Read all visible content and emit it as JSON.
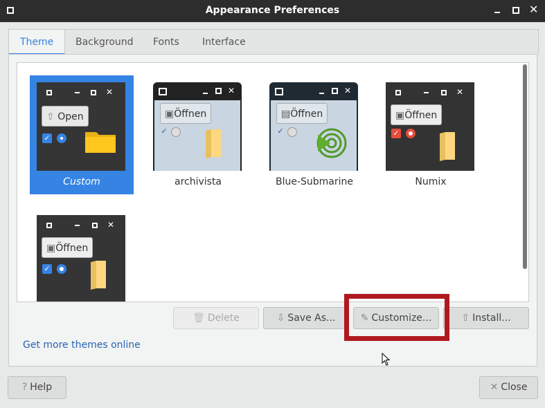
{
  "window": {
    "title": "Appearance Preferences"
  },
  "tabs": [
    {
      "label": "Theme",
      "active": true
    },
    {
      "label": "Background",
      "active": false
    },
    {
      "label": "Fonts",
      "active": false
    },
    {
      "label": "Interface",
      "active": false
    }
  ],
  "themes": [
    {
      "name": "Custom",
      "selected": true,
      "preview": {
        "style": "dark",
        "button_label": "Open",
        "check_color": "#3584e4",
        "radio_color": "#3584e4"
      }
    },
    {
      "name": "archivista",
      "selected": false,
      "preview": {
        "style": "light",
        "button_label": "Öffnen"
      }
    },
    {
      "name": "Blue-Submarine",
      "selected": false,
      "preview": {
        "style": "light",
        "button_label": "Öffnen"
      }
    },
    {
      "name": "Numix",
      "selected": false,
      "preview": {
        "style": "dark",
        "button_label": "Öffnen",
        "check_color": "#e74c3c",
        "radio_color": "#e74c3c"
      }
    },
    {
      "name": "",
      "selected": false,
      "preview": {
        "style": "dark",
        "button_label": "Öffnen",
        "check_color": "#3584e4",
        "radio_color": "#3584e4"
      }
    }
  ],
  "actions": {
    "delete": "Delete",
    "save_as": "Save As...",
    "customize": "Customize...",
    "install": "Install..."
  },
  "link": "Get more themes online",
  "footer": {
    "help": "Help",
    "close": "Close"
  },
  "colors": {
    "accent": "#3584e4",
    "highlight": "#b0181f",
    "titlebar": "#2d2d2d"
  }
}
